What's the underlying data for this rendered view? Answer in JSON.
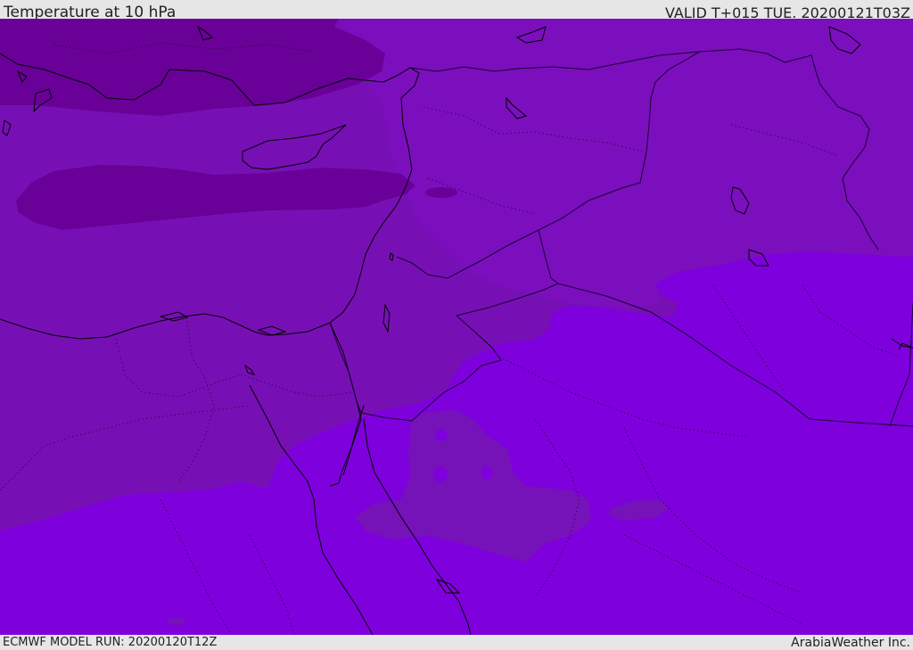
{
  "header": {
    "title": "Temperature at 10 hPa",
    "valid_time": "VALID T+015 TUE. 20200121T03Z"
  },
  "footer": {
    "model_run": "ECMWF MODEL RUN: 20200120T12Z",
    "credit": "ArabiaWeather Inc."
  },
  "palette": {
    "coldest": "#660099",
    "cold": "#770fb5",
    "mid": "#7613b0",
    "warm": "#7e00dc",
    "coast": "#000000",
    "border": "#1a0030"
  }
}
